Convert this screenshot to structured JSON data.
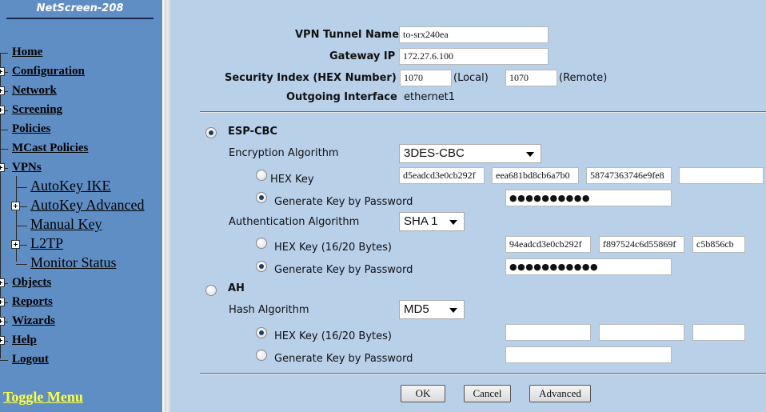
{
  "sidebar": {
    "device_name": "NetScreen-208",
    "items": [
      {
        "label": "Home",
        "expandable": false
      },
      {
        "label": "Configuration",
        "expandable": true
      },
      {
        "label": "Network",
        "expandable": true
      },
      {
        "label": "Screening",
        "expandable": true
      },
      {
        "label": "Policies",
        "expandable": false
      },
      {
        "label": "MCast Policies",
        "expandable": false
      },
      {
        "label": "VPNs",
        "expandable": true
      },
      {
        "label": "AutoKey IKE",
        "expandable": false
      },
      {
        "label": "AutoKey Advanced",
        "expandable": true
      },
      {
        "label": "Manual Key",
        "expandable": false
      },
      {
        "label": "L2TP",
        "expandable": true
      },
      {
        "label": "Monitor Status",
        "expandable": false
      },
      {
        "label": "Objects",
        "expandable": true
      },
      {
        "label": "Reports",
        "expandable": true
      },
      {
        "label": "Wizards",
        "expandable": true
      },
      {
        "label": "Help",
        "expandable": true
      },
      {
        "label": "Logout",
        "expandable": false
      }
    ],
    "toggle_menu": "Toggle Menu"
  },
  "form": {
    "tunnel_name_label": "VPN Tunnel Name",
    "tunnel_name_value": "to-srx240ea",
    "gateway_ip_label": "Gateway IP",
    "gateway_ip_value": "172.27.6.100",
    "spi_label": "Security Index (HEX Number)",
    "spi_local_value": "1070",
    "spi_local_label": "(Local)",
    "spi_remote_value": "1070",
    "spi_remote_label": "(Remote)",
    "outgoing_label": "Outgoing Interface",
    "outgoing_value": "ethernet1",
    "esp": {
      "label": "ESP-CBC",
      "selected": true,
      "encryption_label": "Encryption Algorithm",
      "encryption_value": "3DES-CBC",
      "enc_hex_label": "HEX Key",
      "enc_hex_values": [
        "d5eadcd3e0cb292f",
        "eea681bd8cb6a7b0",
        "58747363746e9fe8",
        ""
      ],
      "enc_hex_selected": false,
      "enc_pw_label": "Generate Key by Password",
      "enc_pw_selected": true,
      "enc_pw_value": "●●●●●●●●●●",
      "auth_label": "Authentication Algorithm",
      "auth_value": "SHA 1",
      "auth_hex_label": "HEX Key (16/20 Bytes)",
      "auth_hex_values": [
        "94eadcd3e0cb292f",
        "f897524c6d55869f",
        "c5b856cb"
      ],
      "auth_hex_selected": false,
      "auth_pw_label": "Generate Key by Password",
      "auth_pw_selected": true,
      "auth_pw_value": "●●●●●●●●●●●"
    },
    "ah": {
      "label": "AH",
      "selected": false,
      "hash_label": "Hash Algorithm",
      "hash_value": "MD5",
      "hex_label": "HEX Key (16/20 Bytes)",
      "hex_values": [
        "",
        "",
        ""
      ],
      "hex_selected": true,
      "pw_label": "Generate Key by Password",
      "pw_selected": false,
      "pw_value": ""
    }
  },
  "buttons": {
    "ok": "OK",
    "cancel": "Cancel",
    "advanced": "Advanced"
  },
  "colors": {
    "sidebar_bg": "#5f8ec5",
    "content_bg": "#b8d0e8",
    "toggle_menu": "#ffff3c"
  }
}
